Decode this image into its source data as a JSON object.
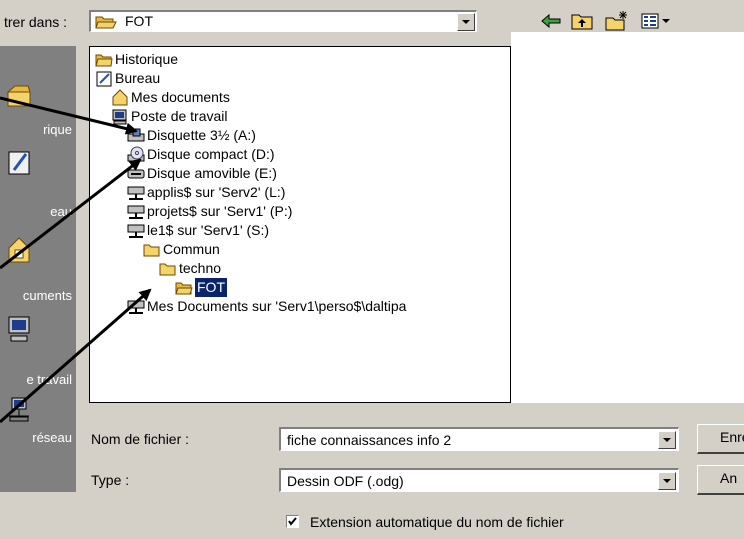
{
  "lookin": {
    "label": "trer dans :",
    "value": "FOT"
  },
  "places": [
    {
      "label": "rique",
      "icon": "history-icon"
    },
    {
      "label": "eau",
      "icon": "desktop-icon"
    },
    {
      "label": "cuments",
      "icon": "my-documents-icon"
    },
    {
      "label": "e travail",
      "icon": "my-computer-icon"
    },
    {
      "label": "réseau",
      "icon": "network-icon"
    }
  ],
  "dropdown_items": [
    {
      "label": "Historique",
      "icon": "folder-icon"
    },
    {
      "label": "Bureau",
      "icon": "desktop-icon"
    },
    {
      "label": "Mes documents",
      "icon": "my-documents-icon"
    },
    {
      "label": "Poste de travail",
      "icon": "my-computer-icon"
    },
    {
      "label": "Disquette 3½ (A:)",
      "icon": "floppy-drive-icon"
    },
    {
      "label": "Disque compact (D:)",
      "icon": "cd-drive-icon"
    },
    {
      "label": "Disque amovible (E:)",
      "icon": "removable-drive-icon"
    },
    {
      "label": "applis$ sur 'Serv2' (L:)",
      "icon": "network-drive-icon"
    },
    {
      "label": "projets$ sur 'Serv1' (P:)",
      "icon": "network-drive-icon"
    },
    {
      "label": "le1$ sur 'Serv1' (S:)",
      "icon": "network-drive-icon"
    },
    {
      "label": "Commun",
      "icon": "folder-icon"
    },
    {
      "label": "techno",
      "icon": "folder-icon"
    },
    {
      "label": "FOT",
      "icon": "open-folder-icon",
      "selected": true
    },
    {
      "label": "Mes Documents sur 'Serv1\\perso$\\daltipa",
      "icon": "network-drive-icon"
    }
  ],
  "form": {
    "filename_label": "Nom de fichier :",
    "filename_value": "fiche connaissances info 2",
    "type_label": "Type :",
    "type_value": "Dessin ODF (.odg)",
    "save_button": "Enre",
    "cancel_button": "An",
    "auto_extension_label": "Extension automatique du nom de fichier",
    "auto_extension_checked": true
  },
  "colors": {
    "selection": "#0a246a",
    "folder": "#f5d36b",
    "dialog": "#d4d0c8",
    "places_bar": "#808080"
  }
}
